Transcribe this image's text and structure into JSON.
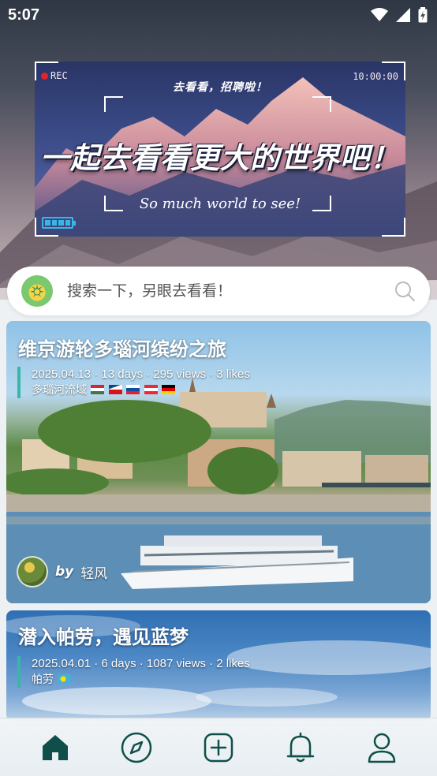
{
  "status_bar": {
    "time": "5:07",
    "icons": [
      "wifi-icon",
      "signal-icon",
      "battery-icon"
    ]
  },
  "banner": {
    "rec_label": "REC",
    "timecode": "10:00:00",
    "slogan_small": "去看看，招聘啦！",
    "title": "一起去看看更大的世界吧！",
    "subtitle": "So much world to see!"
  },
  "search": {
    "placeholder": "搜索一下，另眼去看看！"
  },
  "trips": [
    {
      "title": "维京游轮多瑙河缤纷之旅",
      "meta": "2025.04.13 · 13 days · 295 views · 3 likes",
      "region": "多瑙河流域",
      "flags": [
        "hungary-flag",
        "czech-flag",
        "slovakia-flag",
        "austria-flag",
        "germany-flag"
      ],
      "by_label": "by",
      "author": "轻风"
    },
    {
      "title": "潜入帕劳，遇见蓝梦",
      "meta": "2025.04.01 · 6 days · 1087 views · 2 likes",
      "region": "帕劳",
      "flags": [
        "palau-flag"
      ]
    }
  ],
  "bottom_nav": [
    {
      "icon": "home-icon",
      "active": true
    },
    {
      "icon": "compass-icon",
      "active": false
    },
    {
      "icon": "add-icon",
      "active": false
    },
    {
      "icon": "bell-icon",
      "active": false
    },
    {
      "icon": "profile-icon",
      "active": false
    }
  ],
  "colors": {
    "accent": "#0f4f4a",
    "meta_bar": "#38b6a8",
    "rec_dot": "#e0242b",
    "battery": "#38b6e8"
  }
}
